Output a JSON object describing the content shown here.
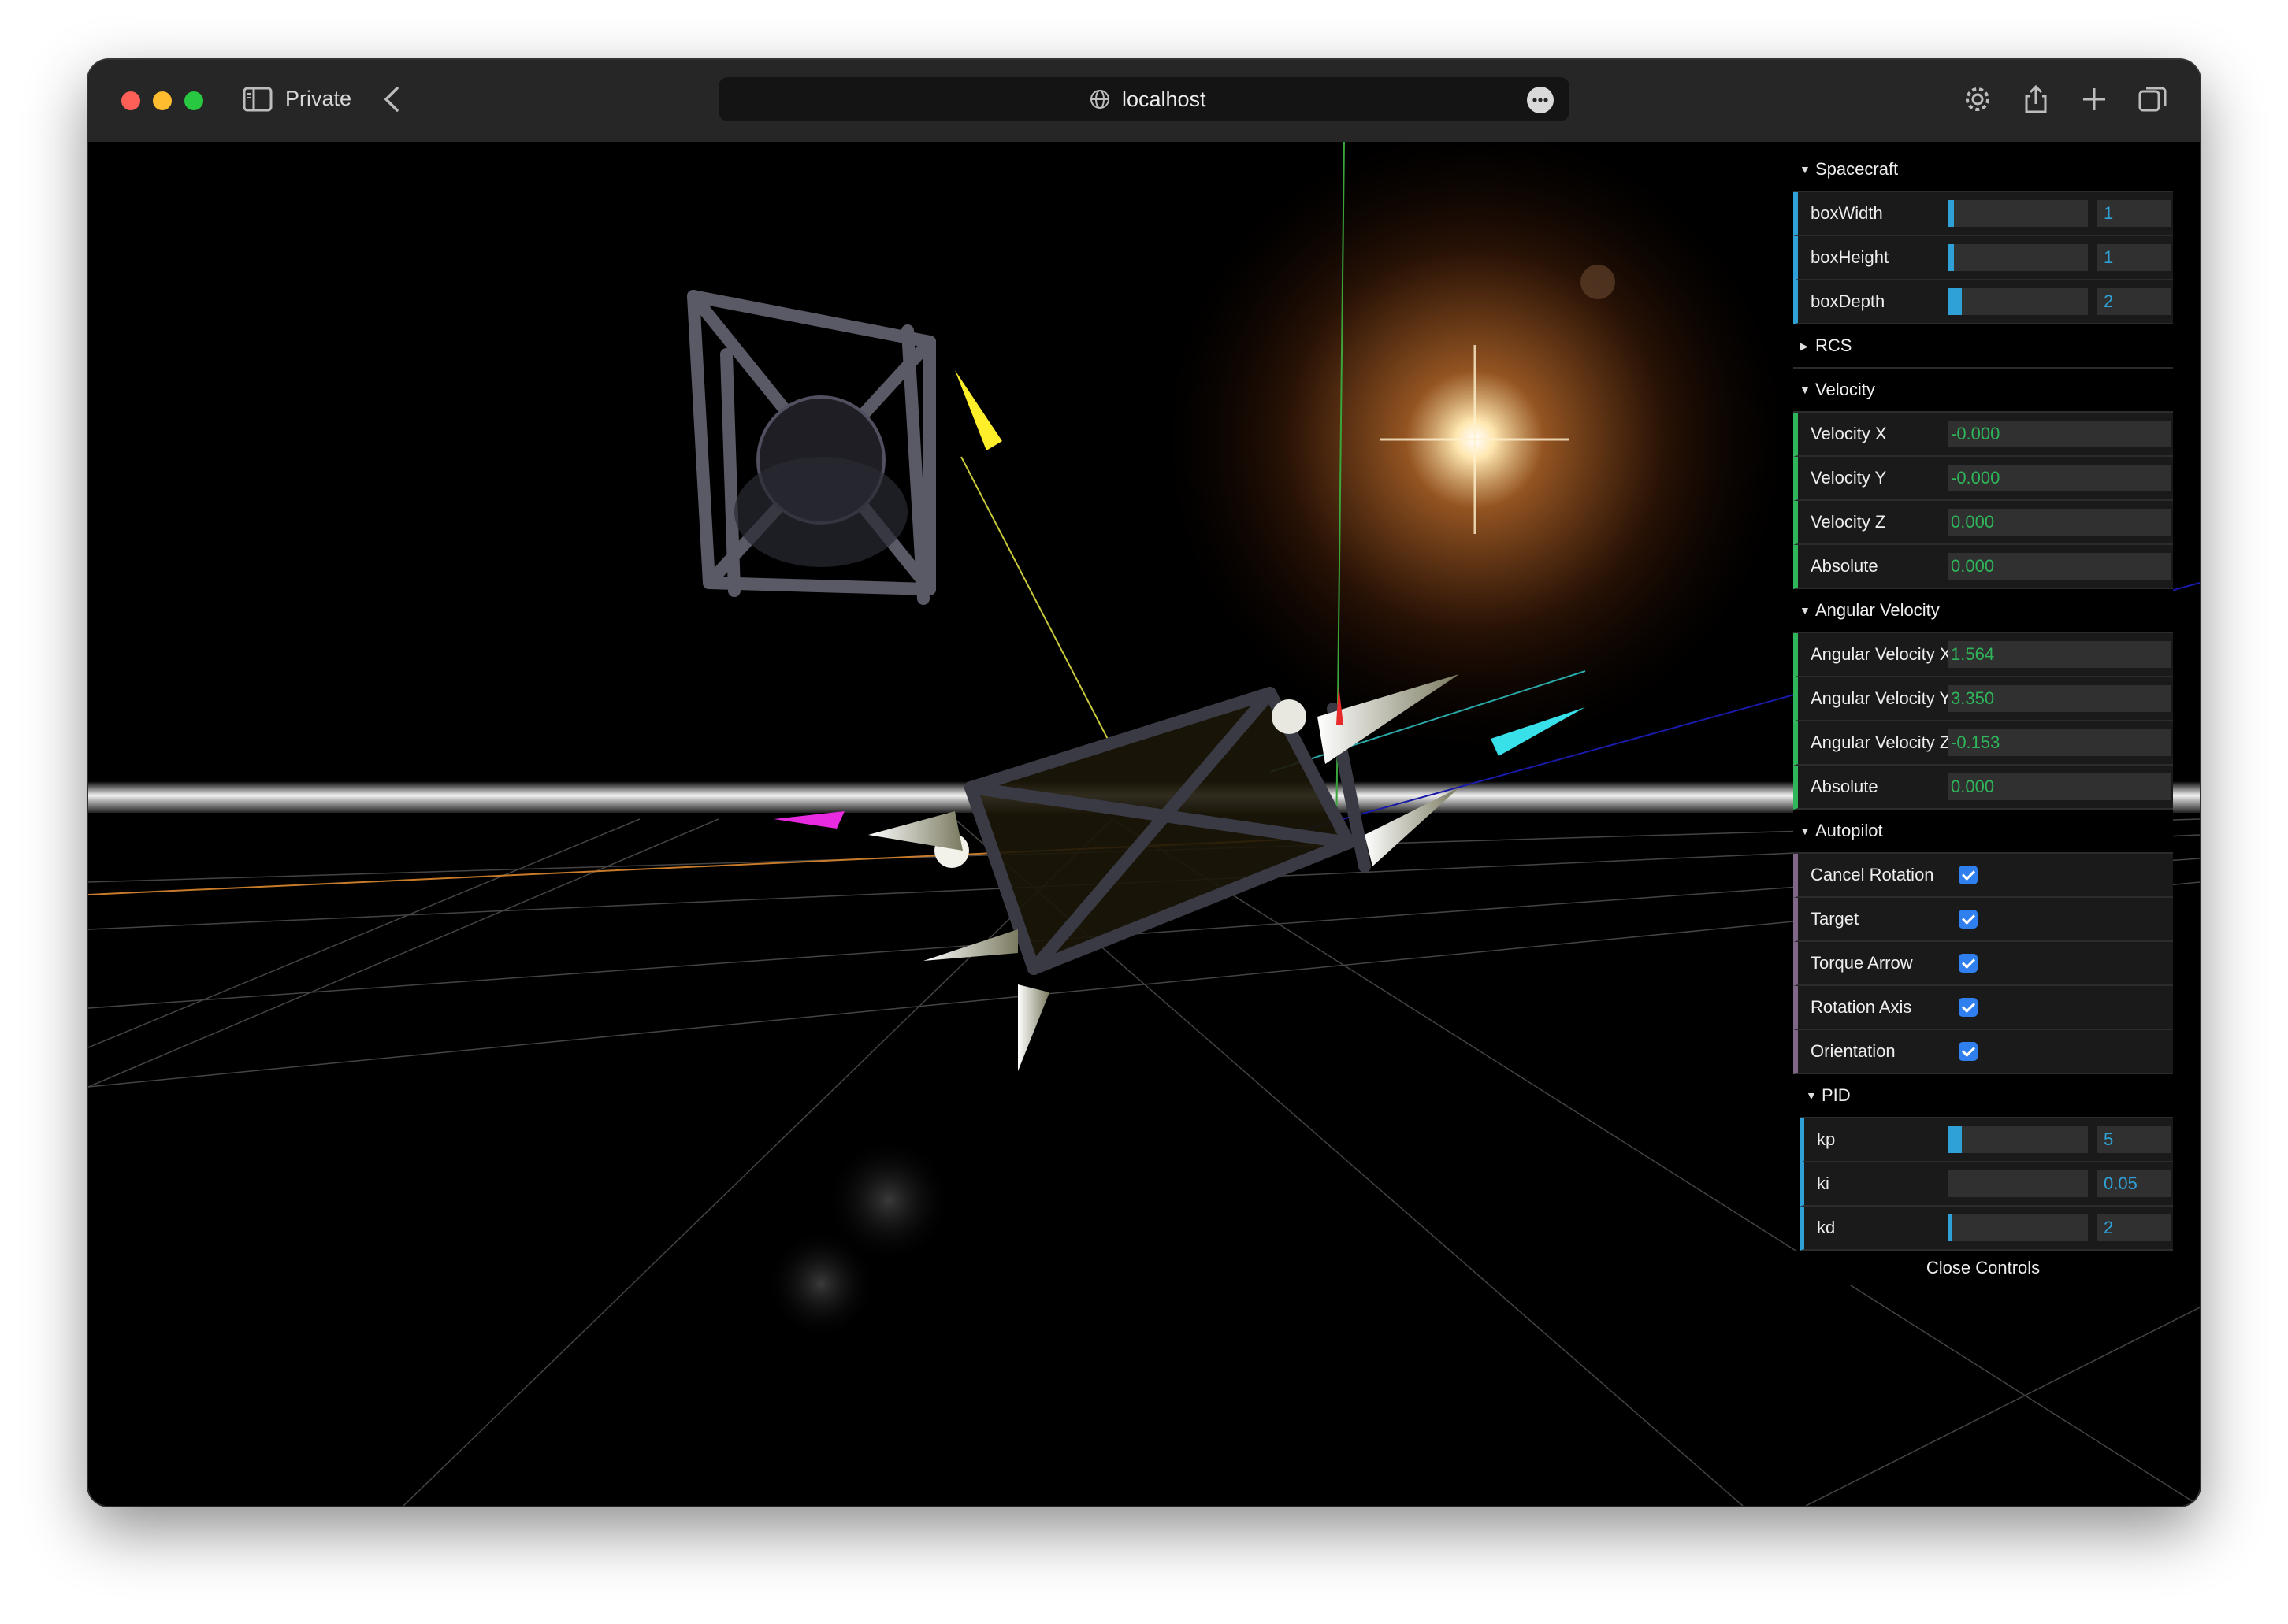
{
  "browser": {
    "private_label": "Private",
    "url": "localhost"
  },
  "gui": {
    "spacecraft": {
      "title": "Spacecraft",
      "rows": [
        {
          "label": "boxWidth",
          "value": "1",
          "fraction": 0.02
        },
        {
          "label": "boxHeight",
          "value": "1",
          "fraction": 0.02
        },
        {
          "label": "boxDepth",
          "value": "2",
          "fraction": 0.1
        }
      ]
    },
    "rcs": {
      "title": "RCS"
    },
    "velocity": {
      "title": "Velocity",
      "rows": [
        {
          "label": "Velocity X",
          "value": "-0.000"
        },
        {
          "label": "Velocity Y",
          "value": "-0.000"
        },
        {
          "label": "Velocity Z",
          "value": "0.000"
        },
        {
          "label": "Absolute",
          "value": "0.000"
        }
      ]
    },
    "angular_velocity": {
      "title": "Angular Velocity",
      "rows": [
        {
          "label": "Angular Velocity X",
          "value": "1.564"
        },
        {
          "label": "Angular Velocity Y",
          "value": "3.350"
        },
        {
          "label": "Angular Velocity Z",
          "value": "-0.153"
        },
        {
          "label": "Absolute",
          "value": "0.000"
        }
      ]
    },
    "autopilot": {
      "title": "Autopilot",
      "rows": [
        {
          "label": "Cancel Rotation",
          "checked": true
        },
        {
          "label": "Target",
          "checked": true
        },
        {
          "label": "Torque Arrow",
          "checked": true
        },
        {
          "label": "Rotation Axis",
          "checked": true
        },
        {
          "label": "Orientation",
          "checked": true
        }
      ]
    },
    "pid": {
      "title": "PID",
      "rows": [
        {
          "label": "kp",
          "value": "5",
          "fraction": 0.05
        },
        {
          "label": "ki",
          "value": "0.05",
          "fraction": 0.0
        },
        {
          "label": "kd",
          "value": "2",
          "fraction": 0.02
        }
      ]
    },
    "close_label": "Close Controls"
  },
  "colors": {
    "number_accent": "#2fa1d6",
    "text_accent": "#2fb55a",
    "bool_accent": "#806787",
    "checkbox": "#2f7fee"
  }
}
